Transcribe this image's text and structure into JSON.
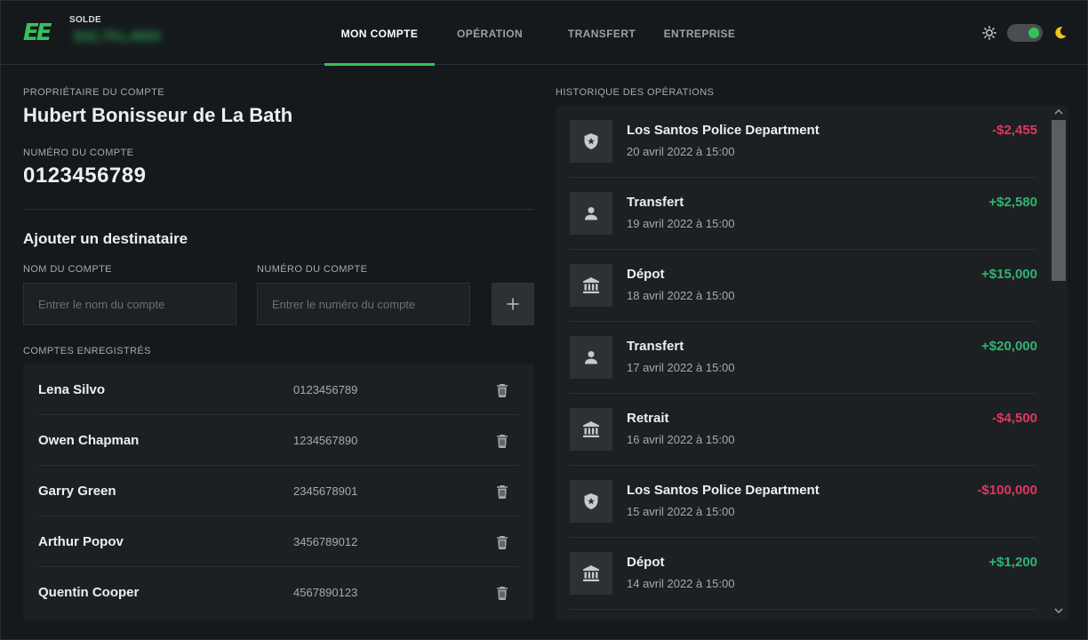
{
  "header": {
    "logo_text": "EE",
    "balance_label": "SOLDE",
    "balance_value": "$32,751,4683",
    "tabs": [
      {
        "label": "MON COMPTE",
        "active": true
      },
      {
        "label": "OPÉRATION",
        "active": false
      },
      {
        "label": "TRANSFERT",
        "active": false
      },
      {
        "label": "ENTREPRISE",
        "active": false
      }
    ],
    "theme_toggle": {
      "state": "dark",
      "accent": "#34c25a"
    }
  },
  "account": {
    "owner_label": "PROPRIÉTAIRE DU COMPTE",
    "owner_name": "Hubert Bonisseur de La Bath",
    "number_label": "NUMÉRO DU COMPTE",
    "number": "0123456789"
  },
  "add_recipient": {
    "title": "Ajouter un destinataire",
    "name_label": "NOM DU COMPTE",
    "name_placeholder": "Entrer le nom du compte",
    "number_label": "NUMÉRO DU COMPTE",
    "number_placeholder": "Entrer le numéro du compte",
    "add_icon": "plus-icon"
  },
  "saved_accounts": {
    "label": "COMPTES ENREGISTRÉS",
    "items": [
      {
        "name": "Lena Silvo",
        "number": "0123456789"
      },
      {
        "name": "Owen Chapman",
        "number": "1234567890"
      },
      {
        "name": "Garry Green",
        "number": "2345678901"
      },
      {
        "name": "Arthur Popov",
        "number": "3456789012"
      },
      {
        "name": "Quentin Cooper",
        "number": "4567890123"
      }
    ]
  },
  "history": {
    "label": "HISTORIQUE DES OPÉRATIONS",
    "items": [
      {
        "icon": "police-badge-icon",
        "title": "Los Santos Police Department",
        "date": "20 avril 2022 à 15:00",
        "amount": "-$2,455",
        "kind": "neg"
      },
      {
        "icon": "person-icon",
        "title": "Transfert",
        "date": "19 avril 2022 à 15:00",
        "amount": "+$2,580",
        "kind": "pos"
      },
      {
        "icon": "bank-icon",
        "title": "Dépot",
        "date": "18 avril 2022 à 15:00",
        "amount": "+$15,000",
        "kind": "pos"
      },
      {
        "icon": "person-icon",
        "title": "Transfert",
        "date": "17 avril 2022 à 15:00",
        "amount": "+$20,000",
        "kind": "pos"
      },
      {
        "icon": "bank-icon",
        "title": "Retrait",
        "date": "16 avril 2022 à 15:00",
        "amount": "-$4,500",
        "kind": "neg"
      },
      {
        "icon": "police-badge-icon",
        "title": "Los Santos Police Department",
        "date": "15 avril 2022 à 15:00",
        "amount": "-$100,000",
        "kind": "neg"
      },
      {
        "icon": "bank-icon",
        "title": "Dépot",
        "date": "14 avril 2022 à 15:00",
        "amount": "+$1,200",
        "kind": "pos"
      }
    ]
  },
  "colors": {
    "accent": "#34c25a",
    "negative": "#e0365f",
    "positive": "#2fb573"
  }
}
